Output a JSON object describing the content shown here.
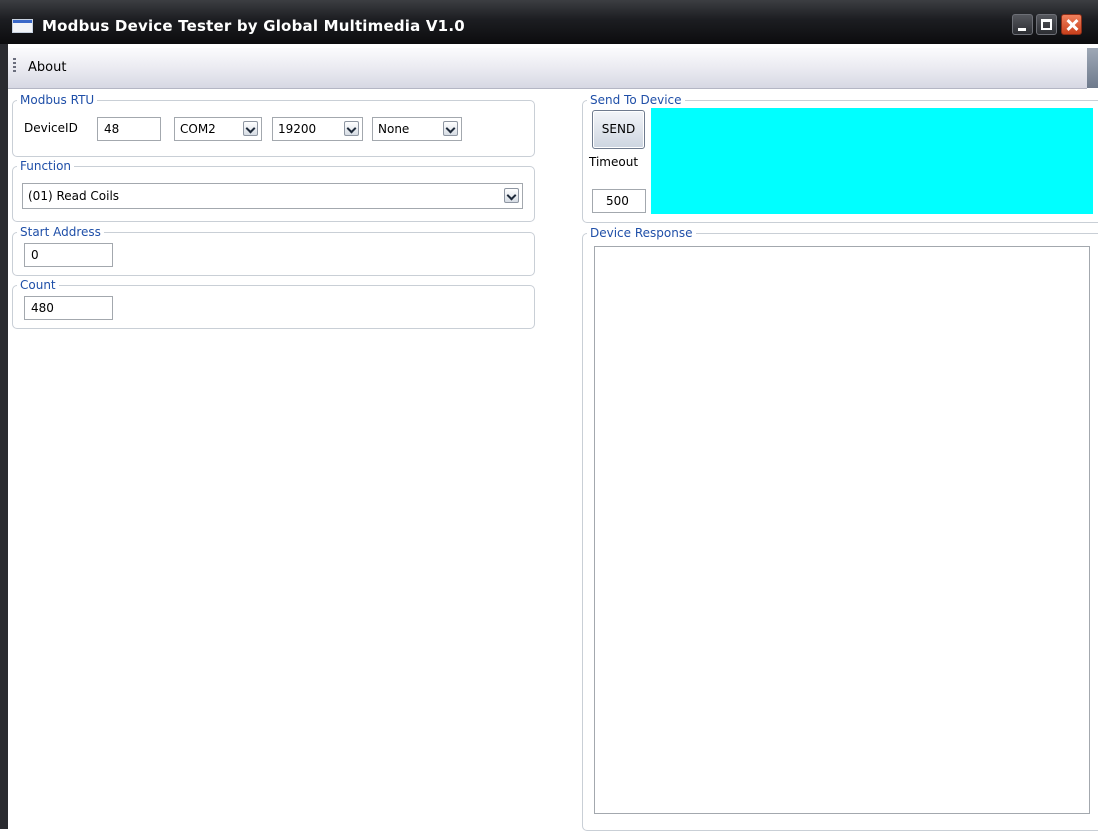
{
  "window": {
    "title": "Modbus Device Tester by Global Multimedia V1.0"
  },
  "menu": {
    "items": [
      {
        "label": "About"
      }
    ]
  },
  "modbus_rtu": {
    "legend": "Modbus RTU",
    "device_id_label": "DeviceID",
    "device_id_value": "48",
    "port_value": "COM2",
    "baud_value": "19200",
    "parity_value": "None"
  },
  "function": {
    "legend": "Function",
    "selected": "(01) Read Coils"
  },
  "start_address": {
    "legend": "Start Address",
    "value": "0"
  },
  "count": {
    "legend": "Count",
    "value": "480"
  },
  "send_to_device": {
    "legend": "Send To Device",
    "send_label": "SEND",
    "timeout_label": "Timeout",
    "timeout_value": "500",
    "payload_color": "#00ffff"
  },
  "device_response": {
    "legend": "Device Response",
    "text": ""
  }
}
